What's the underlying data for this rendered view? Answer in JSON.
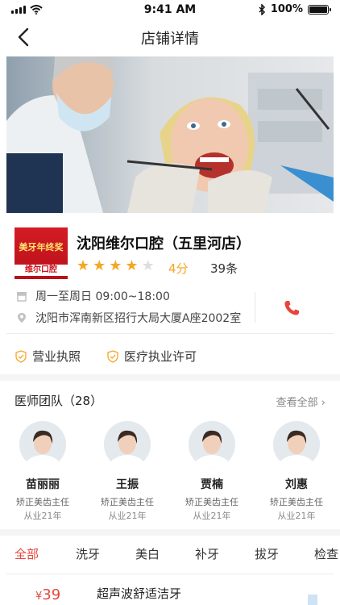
{
  "status_bar": {
    "time": "9:41 AM",
    "battery": "100%",
    "battery_level": 1.0
  },
  "nav": {
    "title": "店铺详情",
    "back_icon": "chevron-left-icon"
  },
  "hero": {
    "image": "dentist-examining-patient-photo"
  },
  "shop": {
    "logo_text_top": "美牙年终奖",
    "logo_text_bottom": "维尔口腔",
    "name": "沈阳维尔口腔（五里河店）",
    "rating": 4,
    "rating_max": 5,
    "score_label": "4分",
    "review_count": "39条",
    "hours": "周一至周日  09:00~18:00",
    "address": "沈阳市浑南新区招行大局大厦A座2002室",
    "phone_icon": "phone-icon",
    "star_color": "#f5a623",
    "star_empty_color": "#dddddd"
  },
  "licenses": [
    {
      "label": "营业执照",
      "icon": "shield-icon"
    },
    {
      "label": "医疗执业许可",
      "icon": "shield-icon"
    }
  ],
  "doctors_section": {
    "title": "医师团队（28）",
    "see_all": "查看全部",
    "doctors": [
      {
        "name": "苗丽丽",
        "title": "矫正美齿主任",
        "years": "从业21年"
      },
      {
        "name": "王振",
        "title": "矫正美齿主任",
        "years": "从业21年"
      },
      {
        "name": "贾楠",
        "title": "矫正美齿主任",
        "years": "从业21年"
      },
      {
        "name": "刘惠",
        "title": "矫正美齿主任",
        "years": "从业21年"
      }
    ]
  },
  "tabs": [
    "全部",
    "洗牙",
    "美白",
    "补牙",
    "拔牙",
    "检查"
  ],
  "active_tab": 0,
  "product": {
    "currency": "¥",
    "price": "39",
    "name": "超声波舒适洁牙"
  },
  "colors": {
    "accent": "#e8453c",
    "star": "#f5a623",
    "logo_red": "#c8101a"
  }
}
